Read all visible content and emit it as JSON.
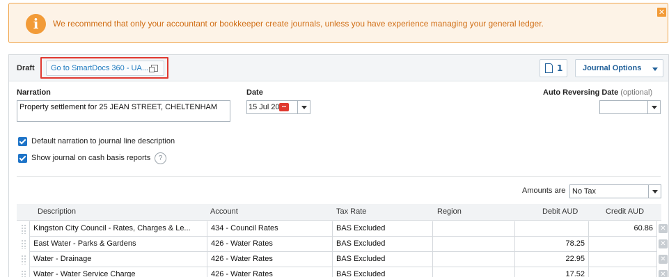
{
  "banner": {
    "icon": "info-icon",
    "text": "We recommend that only your accountant or bookkeeper create journals, unless you have experience managing your general ledger.",
    "close_icon": "close-icon"
  },
  "toolbar": {
    "status": "Draft",
    "smartdocs_label": "Go to SmartDocs 360 - UA...",
    "attachment_count": "1",
    "journal_options_label": "Journal Options"
  },
  "form": {
    "narration_label": "Narration",
    "narration_value": "Property settlement for 25 JEAN STREET, CHELTENHAM",
    "date_label": "Date",
    "date_value": "15 Jul 20",
    "auto_reversing_label": "Auto Reversing Date",
    "auto_reversing_optional": "(optional)",
    "auto_reversing_value": "",
    "default_narration_label": "Default narration to journal line description",
    "show_cash_basis_label": "Show journal on cash basis reports",
    "amounts_are_label": "Amounts are",
    "amounts_are_value": "No Tax"
  },
  "table": {
    "headers": [
      "Description",
      "Account",
      "Tax Rate",
      "Region",
      "Debit AUD",
      "Credit AUD"
    ],
    "rows": [
      {
        "description": "Kingston City Council - Rates, Charges & Le...",
        "account": "434 - Council Rates",
        "tax_rate": "BAS Excluded",
        "region": "",
        "debit": "",
        "credit": "60.86"
      },
      {
        "description": "East Water - Parks & Gardens",
        "account": "426 - Water Rates",
        "tax_rate": "BAS Excluded",
        "region": "",
        "debit": "78.25",
        "credit": ""
      },
      {
        "description": "Water - Drainage",
        "account": "426 - Water Rates",
        "tax_rate": "BAS Excluded",
        "region": "",
        "debit": "22.95",
        "credit": ""
      },
      {
        "description": "Water - Water Service Charge",
        "account": "426 - Water Rates",
        "tax_rate": "BAS Excluded",
        "region": "",
        "debit": "17.52",
        "credit": ""
      }
    ]
  },
  "colors": {
    "banner_border": "#f0a44a",
    "banner_text": "#d06d14",
    "link_blue": "#1f7bc0",
    "checkbox_blue": "#1e74c8",
    "highlight_red": "#e0382f"
  }
}
